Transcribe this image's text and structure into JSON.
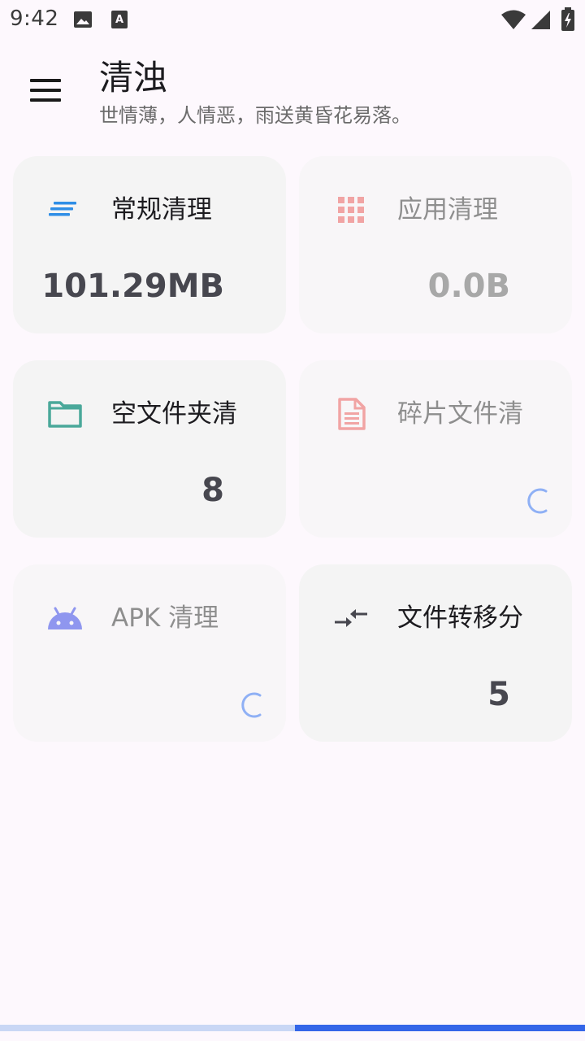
{
  "status": {
    "time": "9:42",
    "icons": [
      "image-icon",
      "a-notification-icon",
      "wifi-icon",
      "signal-icon",
      "battery-charging-icon"
    ]
  },
  "app": {
    "title": "清浊",
    "subtitle": "世情薄，人情恶，雨送黄昏花易落。"
  },
  "cards": [
    {
      "label": "常规清理",
      "value": "101.29MB",
      "icon": "list-lines-icon",
      "state": "active"
    },
    {
      "label": "应用清理",
      "value": "0.0B",
      "icon": "apps-grid-icon",
      "state": "dim"
    },
    {
      "label": "空文件夹清",
      "value": "8",
      "icon": "folder-icon",
      "state": "active"
    },
    {
      "label": "碎片文件清",
      "value": "",
      "icon": "document-icon",
      "state": "loading"
    },
    {
      "label": "APK 清理",
      "value": "",
      "icon": "android-icon",
      "state": "loading"
    },
    {
      "label": "文件转移分",
      "value": "5",
      "icon": "transfer-arrows-icon",
      "state": "active"
    }
  ],
  "colors": {
    "background": "#fdf8fd",
    "card": "#f4f4f4",
    "accent_blue": "#2f8ee6",
    "accent_pink": "#f1a4a4",
    "accent_teal": "#4aa89a",
    "accent_purple": "#8f96ef",
    "progress": "#3466e8"
  },
  "progress": {
    "value": 0.5
  }
}
